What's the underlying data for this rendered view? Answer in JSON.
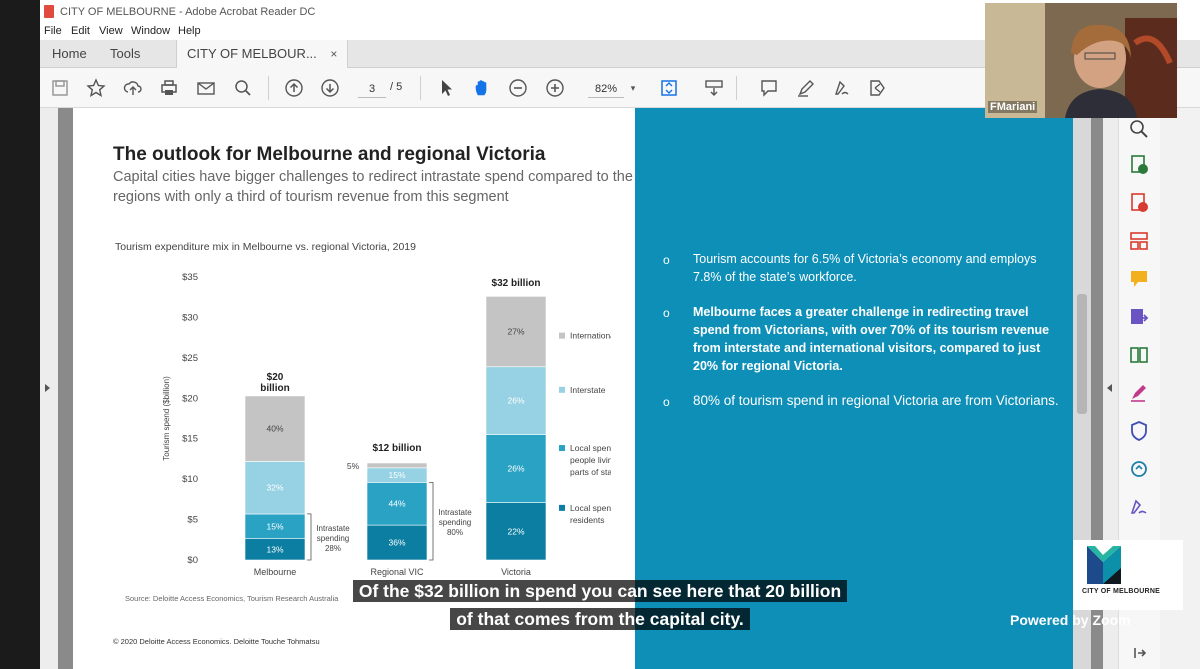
{
  "window": {
    "title": "CITY OF MELBOURNE - Adobe Acrobat Reader DC"
  },
  "menu": [
    "File",
    "Edit",
    "View",
    "Window",
    "Help"
  ],
  "tabs": {
    "home": "Home",
    "tools": "Tools",
    "document": "CITY OF MELBOUR...",
    "close": "×"
  },
  "toolbar": {
    "page_current": "3",
    "page_total": "/ 5",
    "zoom": "82%"
  },
  "slide": {
    "title": "The outlook for Melbourne and regional Victoria",
    "subtitle": "Capital cities have bigger challenges to redirect intrastate spend compared to the regions with only a third of tourism revenue from this segment",
    "chart_title": "Tourism expenditure mix in Melbourne vs. regional Victoria, 2019",
    "source": "Source: Deloitte Access Economics, Tourism Research Australia",
    "copyright": "© 2020 Deloitte Access Economics. Deloitte Touche Tohmatsu",
    "bullets": [
      {
        "text": "Tourism accounts for 6.5% of Victoria’s economy and employs 7.8% of the state’s workforce."
      },
      {
        "text": "Melbourne faces a greater challenge in redirecting travel spend from Victorians, with over 70% of its tourism revenue from interstate and international visitors, compared to just 20% for regional Victoria."
      },
      {
        "text": "80% of tourism spend in regional Victoria are from Victorians."
      }
    ],
    "bullet_marker": "o"
  },
  "chart_data": {
    "type": "bar",
    "stacked": true,
    "categories": [
      "Melbourne",
      "Regional VIC",
      "Victoria"
    ],
    "ylabel": "Tourism spend ($billion)",
    "ylim": [
      0,
      35
    ],
    "yticks": [
      "$0",
      "$5",
      "$10",
      "$15",
      "$20",
      "$25",
      "$30",
      "$35"
    ],
    "totals": [
      "$20 billion",
      "$12 billion",
      "$32 billion"
    ],
    "totals_values": [
      20.3,
      12,
      32.3
    ],
    "series": [
      {
        "name": "Local spend from local residents",
        "values": [
          2.64,
          4.32,
          7.1
        ],
        "labels": [
          "13%",
          "36%",
          "22%"
        ],
        "color": "#0b7ea1"
      },
      {
        "name": "Local spend from people living in other parts of state",
        "values": [
          3.05,
          5.28,
          8.4
        ],
        "labels": [
          "15%",
          "44%",
          "26%"
        ],
        "color": "#2aa2c4"
      },
      {
        "name": "Interstate",
        "values": [
          6.5,
          1.8,
          8.4
        ],
        "labels": [
          "32%",
          "15%",
          "26%"
        ],
        "color": "#97d2e4"
      },
      {
        "name": "International",
        "values": [
          8.1,
          0.6,
          8.7
        ],
        "labels": [
          "40%",
          "5%",
          "27%"
        ],
        "color": "#c4c4c4"
      }
    ],
    "annotations": [
      {
        "text": "Intrastate spending 28%",
        "category": "Melbourne"
      },
      {
        "text": "Intrastate spending 80%",
        "category": "Regional VIC"
      }
    ],
    "legend": [
      "International",
      "Interstate",
      "Local spend from people living in other parts of state",
      "Local spend from local residents"
    ]
  },
  "logo": {
    "text": "CITY OF MELBOURNE"
  },
  "zoom": {
    "powered": "Powered by Zoom",
    "participant": "FMariani"
  },
  "captions": [
    "Of the $32 billion in spend you can see here that 20 billion",
    "of that comes from the capital city."
  ],
  "colors": {
    "panel_blue": "#0d8fb8"
  }
}
